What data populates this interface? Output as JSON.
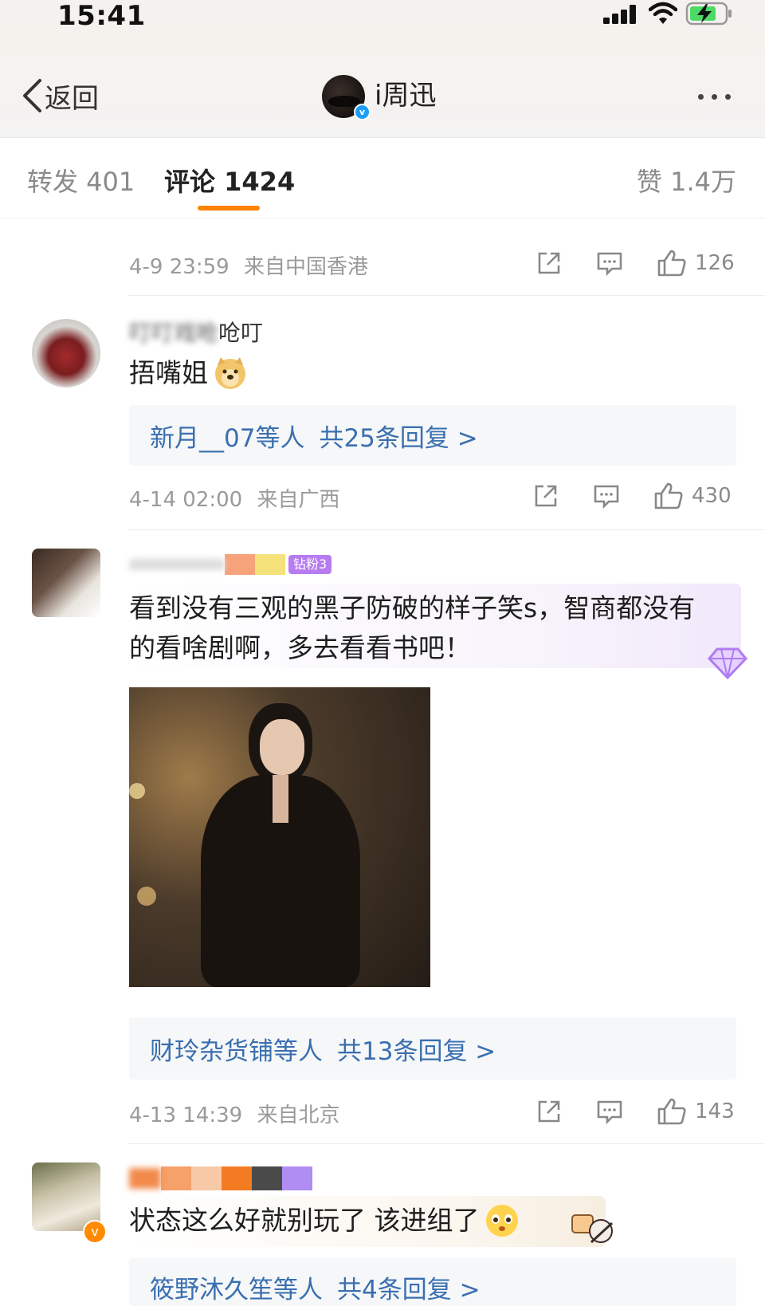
{
  "status_bar": {
    "time": "15:41"
  },
  "nav": {
    "back_label": "返回",
    "title": "i周迅"
  },
  "tabs": {
    "repost": "转发 401",
    "comments": "评论 1424",
    "likes": "赞 1.4万"
  },
  "comments": [
    {
      "time": "4-9 23:59",
      "source": "来自中国香港",
      "likes": "126"
    },
    {
      "username": "呛叮",
      "text": "捂嘴姐",
      "replies_who": "新月__07等人",
      "replies_count": "共25条回复 >",
      "time": "4-14 02:00",
      "source": "来自广西",
      "likes": "430"
    },
    {
      "badge": "钻粉3",
      "text": "看到没有三观的黑子防破的样子笑s，智商都没有的看啥剧啊，多去看看书吧！",
      "replies_who": "财玲杂货铺等人",
      "replies_count": "共13条回复 >",
      "time": "4-13 14:39",
      "source": "来自北京",
      "likes": "143"
    },
    {
      "text": "状态这么好就别玩了 该进组了",
      "replies_who": "筱野沐久笙等人",
      "replies_count": "共4条回复 >"
    }
  ],
  "colors": {
    "accent": "#ff8200",
    "link": "#3a6fb0",
    "verified": "#1e9df4"
  },
  "icons": [
    "signal-icon",
    "wifi-icon",
    "battery-icon",
    "back-icon",
    "more-icon",
    "share-icon",
    "comment-icon",
    "like-icon",
    "doge-emoji-icon",
    "fan-badge-icon",
    "blush-emoji-icon"
  ]
}
